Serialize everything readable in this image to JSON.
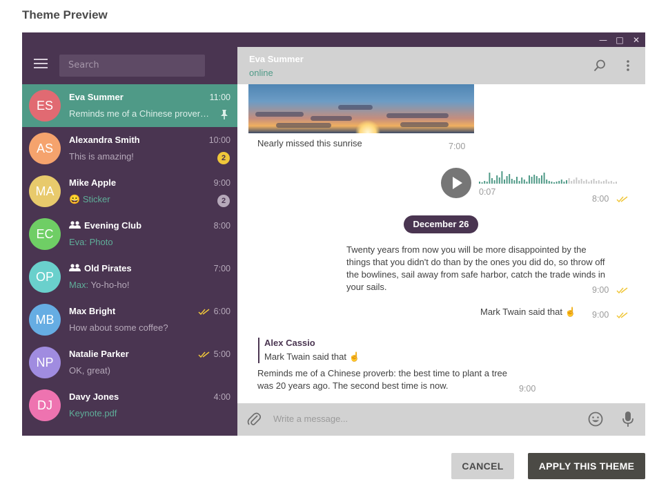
{
  "dialog": {
    "title": "Theme Preview"
  },
  "sidebar": {
    "search_placeholder": "Search",
    "chats": [
      {
        "initials": "ES",
        "color": "#e16a72",
        "name": "Eva Summer",
        "time": "11:00",
        "preview": "Reminds me of a Chinese prover…",
        "pinned": true,
        "active": true
      },
      {
        "initials": "AS",
        "color": "#f5a36d",
        "name": "Alexandra Smith",
        "time": "10:00",
        "preview": "This is amazing!",
        "badge": "2",
        "badge_color": "#f0c73a"
      },
      {
        "initials": "MA",
        "color": "#e8ca6c",
        "name": "Mike Apple",
        "time": "9:00",
        "preview_emoji": "😀",
        "preview_accent": "Sticker",
        "badge": "2",
        "badge_color": "#b6a9ba"
      },
      {
        "initials": "EC",
        "color": "#6fce65",
        "name": "Evening Club",
        "time": "8:00",
        "preview_accent": "Eva: Photo",
        "group": true
      },
      {
        "initials": "OP",
        "color": "#6ad0cc",
        "name": "Old Pirates",
        "time": "7:00",
        "preview_accent": "Max:",
        "preview": " Yo-ho-ho!",
        "group": true
      },
      {
        "initials": "MB",
        "color": "#66ade3",
        "name": "Max Bright",
        "time": "6:00",
        "preview": "How about some coffee?",
        "read": true
      },
      {
        "initials": "NP",
        "color": "#a08ce0",
        "name": "Natalie Parker",
        "time": "5:00",
        "preview": "OK, great)",
        "read": true
      },
      {
        "initials": "DJ",
        "color": "#ee73b0",
        "name": "Davy Jones",
        "time": "4:00",
        "preview_accent": "Keynote.pdf"
      }
    ]
  },
  "chat": {
    "name": "Eva Summer",
    "status": "online",
    "messages": {
      "photo_caption": "Nearly missed this sunrise",
      "photo_time": "7:00",
      "voice_duration": "0:07",
      "voice_time": "8:00",
      "date_separator": "December 26",
      "quote_line1": "Twenty years from now you will be more disappointed by the",
      "quote_line2": "things that you didn't do than by the ones you did do, so throw off",
      "quote_line3": "the bowlines, sail away from safe harbor, catch the trade winds in",
      "quote_line4": "your sails.",
      "quote_time": "9:00",
      "twain_text": "Mark Twain said that ☝️",
      "twain_time": "9:00",
      "reply_author": "Alex Cassio",
      "reply_quote": "Mark Twain said that ☝️",
      "reply_line1": "Reminds me of a Chinese proverb: the best time to plant a tree",
      "reply_line2": "was 20 years ago. The second best time is now.",
      "reply_time": "9:00"
    },
    "composer_placeholder": "Write a message..."
  },
  "buttons": {
    "cancel": "CANCEL",
    "apply": "APPLY THIS THEME"
  },
  "colors": {
    "sidebar_bg": "#4a3551",
    "accent": "#4f9a87",
    "check": "#f0c73a"
  }
}
